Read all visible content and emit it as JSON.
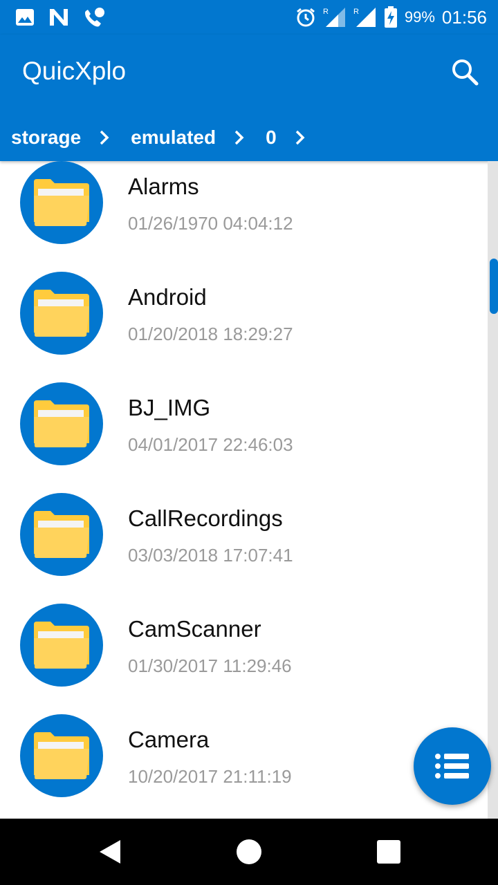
{
  "status_bar": {
    "battery_percent": "99%",
    "time": "01:56",
    "left_icons": [
      "image-icon",
      "n-icon",
      "wifi-call-icon"
    ],
    "right_icons": [
      "alarm-icon",
      "signal-icon",
      "signal-icon",
      "battery-charging-icon"
    ]
  },
  "app_bar": {
    "title": "QuicXplo",
    "search_icon": "search-icon"
  },
  "breadcrumb": [
    "storage",
    "emulated",
    "0"
  ],
  "files": [
    {
      "name": "Alarms",
      "date": "01/26/1970 04:04:12"
    },
    {
      "name": "Android",
      "date": "01/20/2018 18:29:27"
    },
    {
      "name": "BJ_IMG",
      "date": "04/01/2017 22:46:03"
    },
    {
      "name": "CallRecordings",
      "date": "03/03/2018 17:07:41"
    },
    {
      "name": "CamScanner",
      "date": "01/30/2017 11:29:46"
    },
    {
      "name": "Camera",
      "date": "10/20/2017 21:11:19"
    }
  ],
  "fab": {
    "icon": "list-icon"
  },
  "scrollbar": {
    "position_fraction": 0.15
  },
  "nav_bar": [
    "back-icon",
    "home-icon",
    "recents-icon"
  ],
  "colors": {
    "primary": "#0277cf",
    "folder": "#ffd35c",
    "date_text": "#9a9a9a"
  }
}
